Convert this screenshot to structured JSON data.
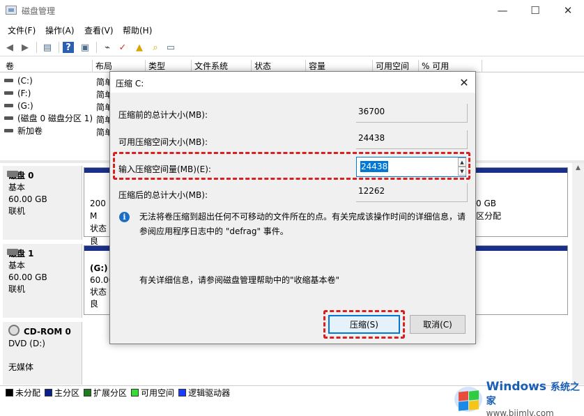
{
  "window": {
    "title": "磁盘管理",
    "minimize": "—",
    "maximize": "☐",
    "close": "✕"
  },
  "menu": [
    "文件(F)",
    "操作(A)",
    "查看(V)",
    "帮助(H)"
  ],
  "columns": [
    "卷",
    "布局",
    "类型",
    "文件系统",
    "状态",
    "容量",
    "可用空间",
    "% 可用"
  ],
  "volumes": [
    {
      "name": "(C:)",
      "layout": "简单"
    },
    {
      "name": "(F:)",
      "layout": "简单"
    },
    {
      "name": "(G:)",
      "layout": "简单"
    },
    {
      "name": "(磁盘 0 磁盘分区 1)",
      "layout": "简单"
    },
    {
      "name": "新加卷",
      "layout": "简单"
    }
  ],
  "disks": [
    {
      "name": "磁盘 0",
      "type": "基本",
      "size": "60.00 GB",
      "status": "联机",
      "part_left": {
        "line1": "200 M",
        "line2": "状态良"
      },
      "part_right": {
        "line1": "0 GB",
        "line2": "区分配"
      }
    },
    {
      "name": "磁盘 1",
      "type": "基本",
      "size": "60.00 GB",
      "status": "联机",
      "part_left": {
        "line1": "(G:)",
        "line2": "60.00",
        "line3": "状态良"
      }
    },
    {
      "name": "CD-ROM 0",
      "type": "DVD (D:)",
      "size": "",
      "status": "无媒体"
    }
  ],
  "legend": [
    {
      "label": "未分配",
      "color": "#000000"
    },
    {
      "label": "主分区",
      "color": "#0a1f8c"
    },
    {
      "label": "扩展分区",
      "color": "#1e7b1e"
    },
    {
      "label": "可用空间",
      "color": "#33dd33"
    },
    {
      "label": "逻辑驱动器",
      "color": "#1a3cff"
    }
  ],
  "dialog": {
    "title": "压缩 C:",
    "close": "✕",
    "fields": [
      {
        "label": "压缩前的总计大小(MB):",
        "value": "36700"
      },
      {
        "label": "可用压缩空间大小(MB):",
        "value": "24438"
      }
    ],
    "input_label": "输入压缩空间量(MB)(E):",
    "input_value": "24438",
    "after_label": "压缩后的总计大小(MB):",
    "after_value": "12262",
    "info_icon": "i",
    "info_text": "无法将卷压缩到超出任何不可移动的文件所在的点。有关完成该操作时间的详细信息，请参阅应用程序日志中的 \"defrag\" 事件。",
    "more_info": "有关详细信息，请参阅磁盘管理帮助中的\"收缩基本卷\"",
    "ok_label": "压缩(S)",
    "cancel_label": "取消(C)"
  },
  "watermark": {
    "brand": "Windows",
    "brand_cn": "系统之家",
    "url": "www.bjjmlv.com"
  }
}
